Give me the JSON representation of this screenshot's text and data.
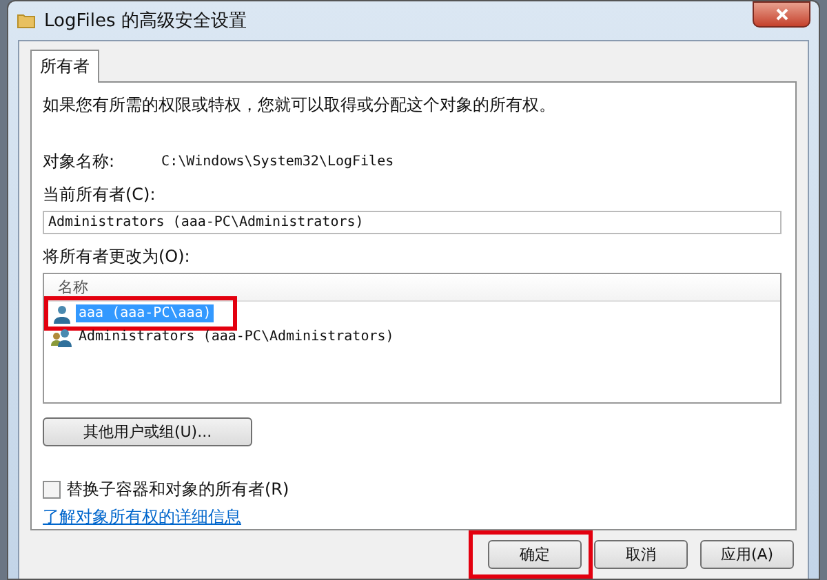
{
  "window": {
    "title": "LogFiles 的高级安全设置"
  },
  "tabs": [
    {
      "label": "所有者",
      "selected": true
    }
  ],
  "description": "如果您有所需的权限或特权，您就可以取得或分配这个对象的所有权。",
  "object_name": {
    "label": "对象名称:",
    "value": "C:\\Windows\\System32\\LogFiles"
  },
  "current_owner": {
    "label": "当前所有者(C):",
    "value": "Administrators (aaa-PC\\Administrators)"
  },
  "change_owner": {
    "label": "将所有者更改为(O):",
    "column": "名称",
    "rows": [
      {
        "name": "aaa (aaa-PC\\aaa)",
        "kind": "user",
        "selected": true,
        "highlighted": true
      },
      {
        "name": "Administrators (aaa-PC\\Administrators)",
        "kind": "group",
        "selected": false,
        "highlighted": false
      }
    ]
  },
  "other_button": "其他用户或组(U)...",
  "replace_checkbox": {
    "label": "替换子容器和对象的所有者(R)",
    "checked": false
  },
  "link": "了解对象所有权的详细信息",
  "buttons": [
    {
      "label": "确定",
      "highlighted": true
    },
    {
      "label": "取消",
      "highlighted": false
    },
    {
      "label": "应用(A)",
      "highlighted": false
    }
  ]
}
